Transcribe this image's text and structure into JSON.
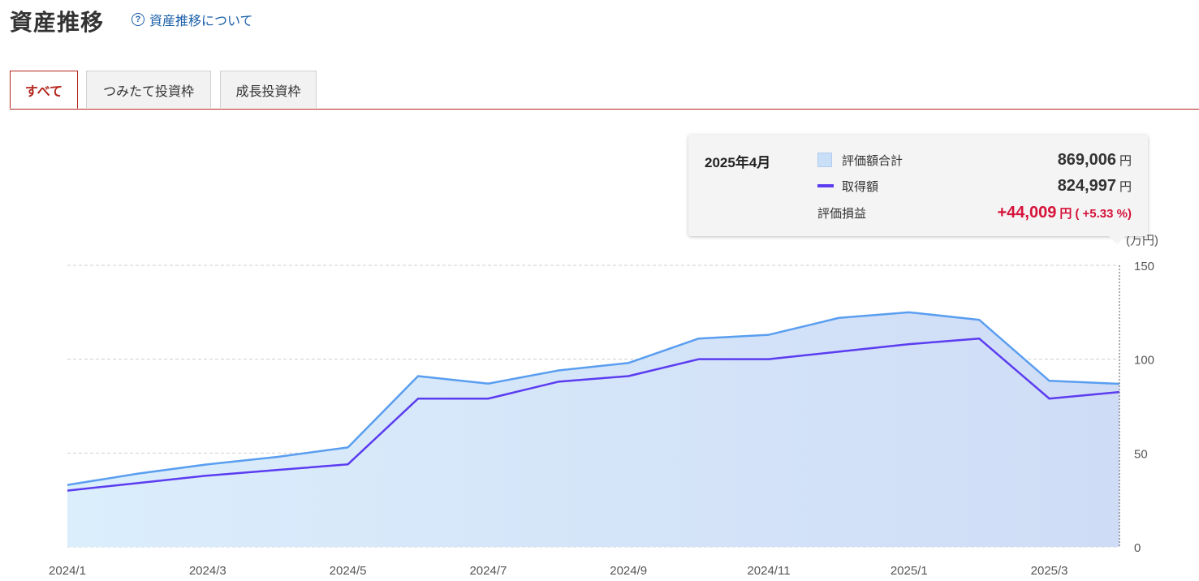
{
  "header": {
    "title": "資産推移",
    "help_label": "資産推移について",
    "help_icon": "question-circle-icon"
  },
  "tabs": [
    {
      "label": "すべて",
      "active": true
    },
    {
      "label": "つみたて投資枠",
      "active": false
    },
    {
      "label": "成長投資枠",
      "active": false
    }
  ],
  "tooltip": {
    "date": "2025年4月",
    "total_label": "評価額合計",
    "total_value": "869,006",
    "cost_label": "取得額",
    "cost_value": "824,997",
    "gain_label": "評価損益",
    "gain_value": "+44,009",
    "gain_percent": "( +5.33 %)",
    "unit": "円"
  },
  "colors": {
    "accent": "#b3261e",
    "area_fill_start": "#dbeefc",
    "area_fill_end": "#cfdcf6",
    "total_line": "#5a9ef0",
    "cost_line": "#5b3cf0",
    "gain": "#d6133a"
  },
  "chart_data": {
    "type": "area",
    "unit_label": "(万円)",
    "x": [
      "2024/1",
      "2024/2",
      "2024/3",
      "2024/4",
      "2024/5",
      "2024/6",
      "2024/7",
      "2024/8",
      "2024/9",
      "2024/10",
      "2024/11",
      "2024/12",
      "2025/1",
      "2025/2",
      "2025/3",
      "2025/4"
    ],
    "x_tick_labels": [
      "2024/1",
      "2024/3",
      "2024/5",
      "2024/7",
      "2024/9",
      "2024/11",
      "2025/1",
      "2025/3"
    ],
    "series": [
      {
        "name": "評価額合計",
        "values": [
          33,
          39,
          44,
          48,
          53,
          91,
          87,
          94,
          98,
          111,
          113,
          122,
          125,
          121,
          88.5,
          86.9
        ]
      },
      {
        "name": "取得額",
        "values": [
          30,
          34,
          38,
          41,
          44,
          79,
          79,
          88,
          91,
          100,
          100,
          104,
          108,
          111,
          79,
          82.5
        ]
      }
    ],
    "ylim": [
      0,
      150
    ],
    "y_ticks": [
      0,
      50,
      100,
      150
    ],
    "grid": true,
    "highlight_index": 15
  }
}
